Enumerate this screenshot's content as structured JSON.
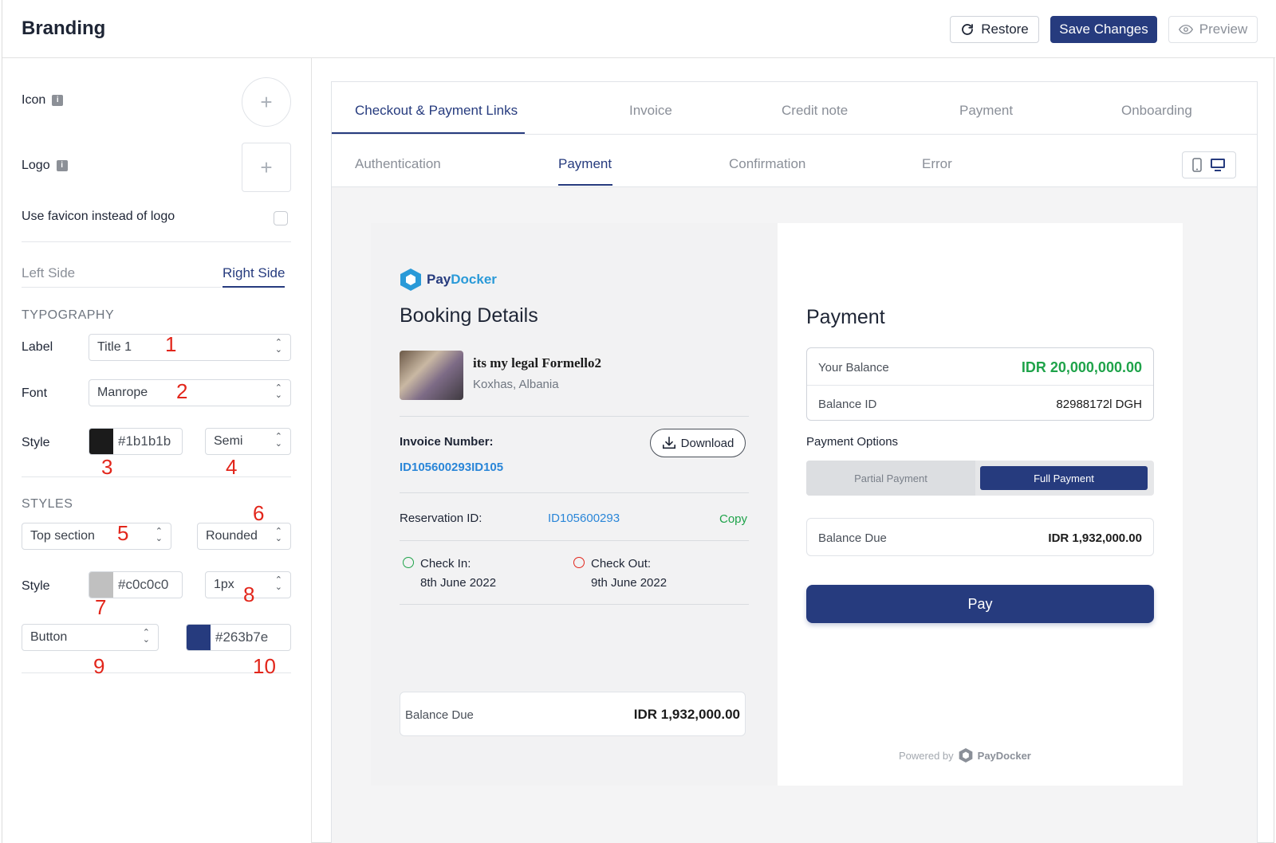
{
  "header": {
    "title": "Branding",
    "restore_label": "Restore",
    "save_label": "Save Changes",
    "preview_label": "Preview"
  },
  "sidebar": {
    "icon_label": "Icon",
    "logo_label": "Logo",
    "favicon_label": "Use favicon instead of logo",
    "favicon_checked": false,
    "side_tabs": [
      "Left Side",
      "Right Side"
    ],
    "active_side_tab": "Right Side",
    "typography": {
      "heading": "TYPOGRAPHY",
      "label_title": "Label",
      "label_value": "Title 1",
      "font_title": "Font",
      "font_value": "Manrope",
      "style_title": "Style",
      "color_value": "#1b1b1b",
      "weight_value": "Semi"
    },
    "styles": {
      "heading": "STYLES",
      "section_value": "Top section",
      "shape_value": "Rounded",
      "style_title": "Style",
      "border_color": "#c0c0c0",
      "border_width": "1px",
      "element_value": "Button",
      "element_color": "#263b7e"
    },
    "annotations": [
      "1",
      "2",
      "3",
      "4",
      "5",
      "6",
      "7",
      "8",
      "9",
      "10"
    ]
  },
  "preview": {
    "main_tabs": [
      "Checkout & Payment Links",
      "Invoice",
      "Credit note",
      "Payment",
      "Onboarding"
    ],
    "active_main_tab": "Checkout & Payment Links",
    "sub_tabs": [
      "Authentication",
      "Payment",
      "Confirmation",
      "Error"
    ],
    "active_sub_tab": "Payment",
    "booking": {
      "brand_pay": "Pay",
      "brand_docker": "Docker",
      "title": "Booking Details",
      "property_name": "its my legal Formello2",
      "property_location": "Koxhas, Albania",
      "invoice_label": "Invoice Number:",
      "invoice_value": "ID105600293ID105",
      "download_label": "Download",
      "reservation_label": "Reservation ID:",
      "reservation_value": "ID105600293",
      "copy_label": "Copy",
      "check_in_label": "Check In:",
      "check_in_date": "8th June 2022",
      "check_out_label": "Check Out:",
      "check_out_date": "9th June 2022",
      "balance_due_label": "Balance Due",
      "balance_due_value": "IDR 1,932,000.00"
    },
    "payment": {
      "title": "Payment",
      "your_balance_label": "Your Balance",
      "your_balance_value": "IDR 20,000,000.00",
      "balance_id_label": "Balance ID",
      "balance_id_value": "82988172l DGH",
      "options_label": "Payment Options",
      "option_partial": "Partial Payment",
      "option_full": "Full Payment",
      "active_option": "Full Payment",
      "balance_due_label": "Balance Due",
      "balance_due_value": "IDR 1,932,000.00",
      "pay_label": "Pay",
      "powered_by": "Powered by",
      "powered_brand": "PayDocker"
    }
  },
  "colors": {
    "accent": "#263b7e",
    "link": "#2a86d8",
    "success": "#1fa34a",
    "annotation": "#e2261b"
  }
}
